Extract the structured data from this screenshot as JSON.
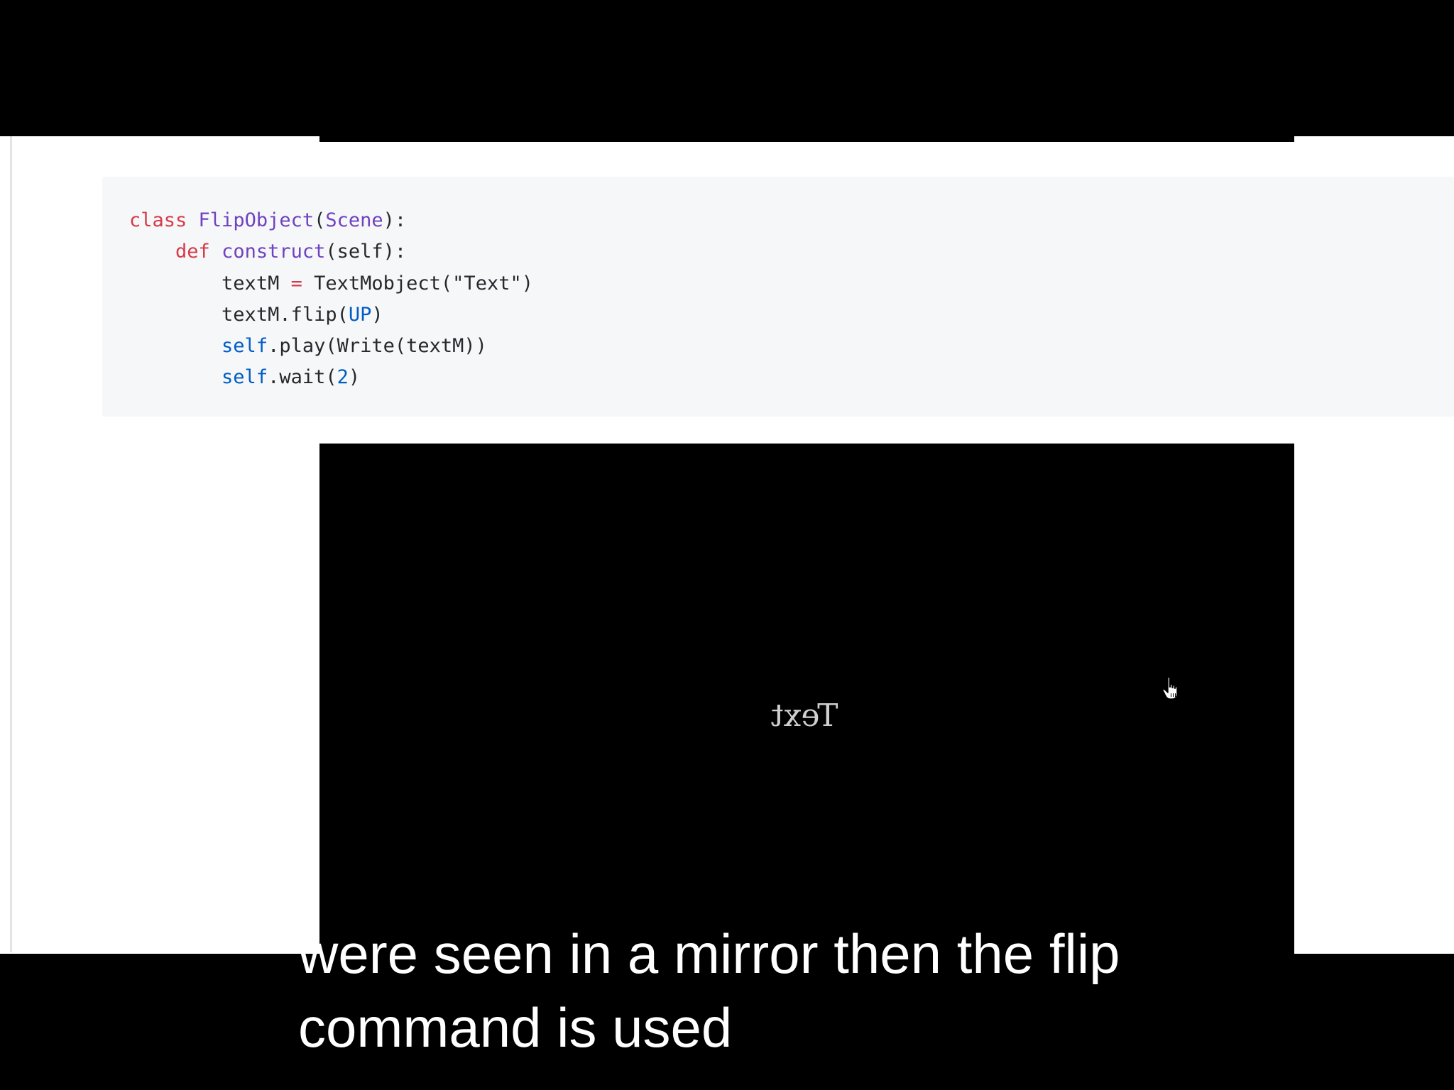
{
  "code": {
    "line1": {
      "kw": "class",
      "name": "FlipObject",
      "open": "(",
      "base": "Scene",
      "close": "):"
    },
    "line2": {
      "kw": "def",
      "name": "construct",
      "rest": "(self):"
    },
    "line3": {
      "var": "textM ",
      "op": "=",
      "rest": " TextMobject(\"Text\")"
    },
    "line4": {
      "pre": "textM.flip(",
      "const": "UP",
      "post": ")"
    },
    "line5": {
      "self": "self",
      "rest": ".play(Write(textM))"
    },
    "line6": {
      "self": "self",
      "pre": ".wait(",
      "num": "2",
      "post": ")"
    }
  },
  "video": {
    "rendered_text": "Text"
  },
  "caption": {
    "line1": "were seen in a mirror then the flip",
    "line2": "command is used"
  },
  "colors": {
    "keyword": "#d73a49",
    "class_name": "#6f42c1",
    "constant": "#005cc5",
    "code_background": "#f6f7f8",
    "video_background": "#000000"
  },
  "icons": {
    "cursor": "hand-pointer-icon"
  }
}
